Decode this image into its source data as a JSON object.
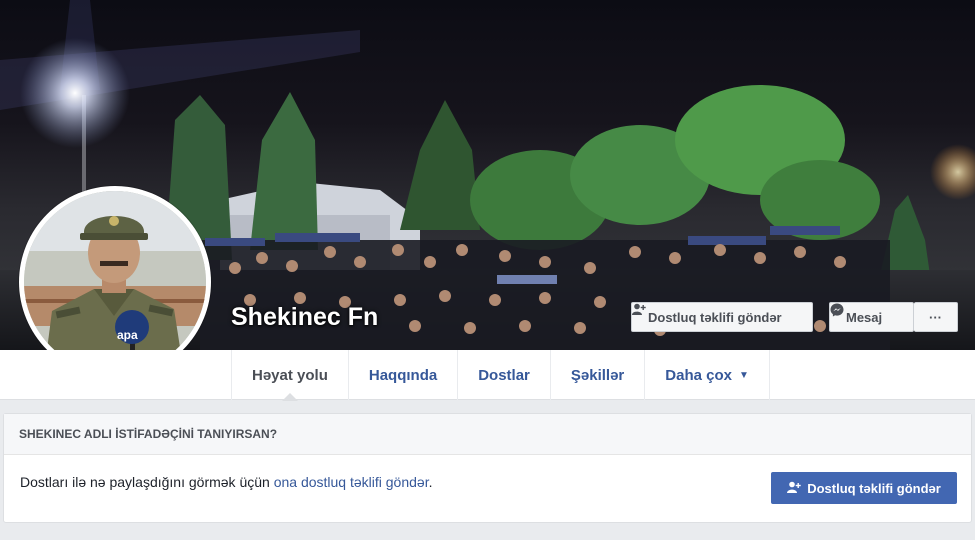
{
  "profile": {
    "name": "Shekinec Fn"
  },
  "actions": {
    "add_friend_label": "Dostluq təklifi göndər",
    "message_label": "Mesaj",
    "more_label": "···"
  },
  "nav": {
    "tabs": [
      {
        "label": "Həyat yolu",
        "active": true
      },
      {
        "label": "Haqqında"
      },
      {
        "label": "Dostlar"
      },
      {
        "label": "Şəkillər"
      },
      {
        "label": "Daha çox"
      }
    ]
  },
  "know_card": {
    "heading": "SHEKINEC ADLI İSTİFADƏÇİNİ TANIYIRSAN?",
    "text": "Dostları ilə nə paylaşdığını görmək üçün ",
    "link": "ona dostluq təklifi göndər",
    "period": ".",
    "button_label": "Dostluq təklifi göndər"
  },
  "avatar_watermark": "apa",
  "colors": {
    "primary": "#4267b2",
    "link": "#365899",
    "page_bg": "#e9ebee"
  }
}
